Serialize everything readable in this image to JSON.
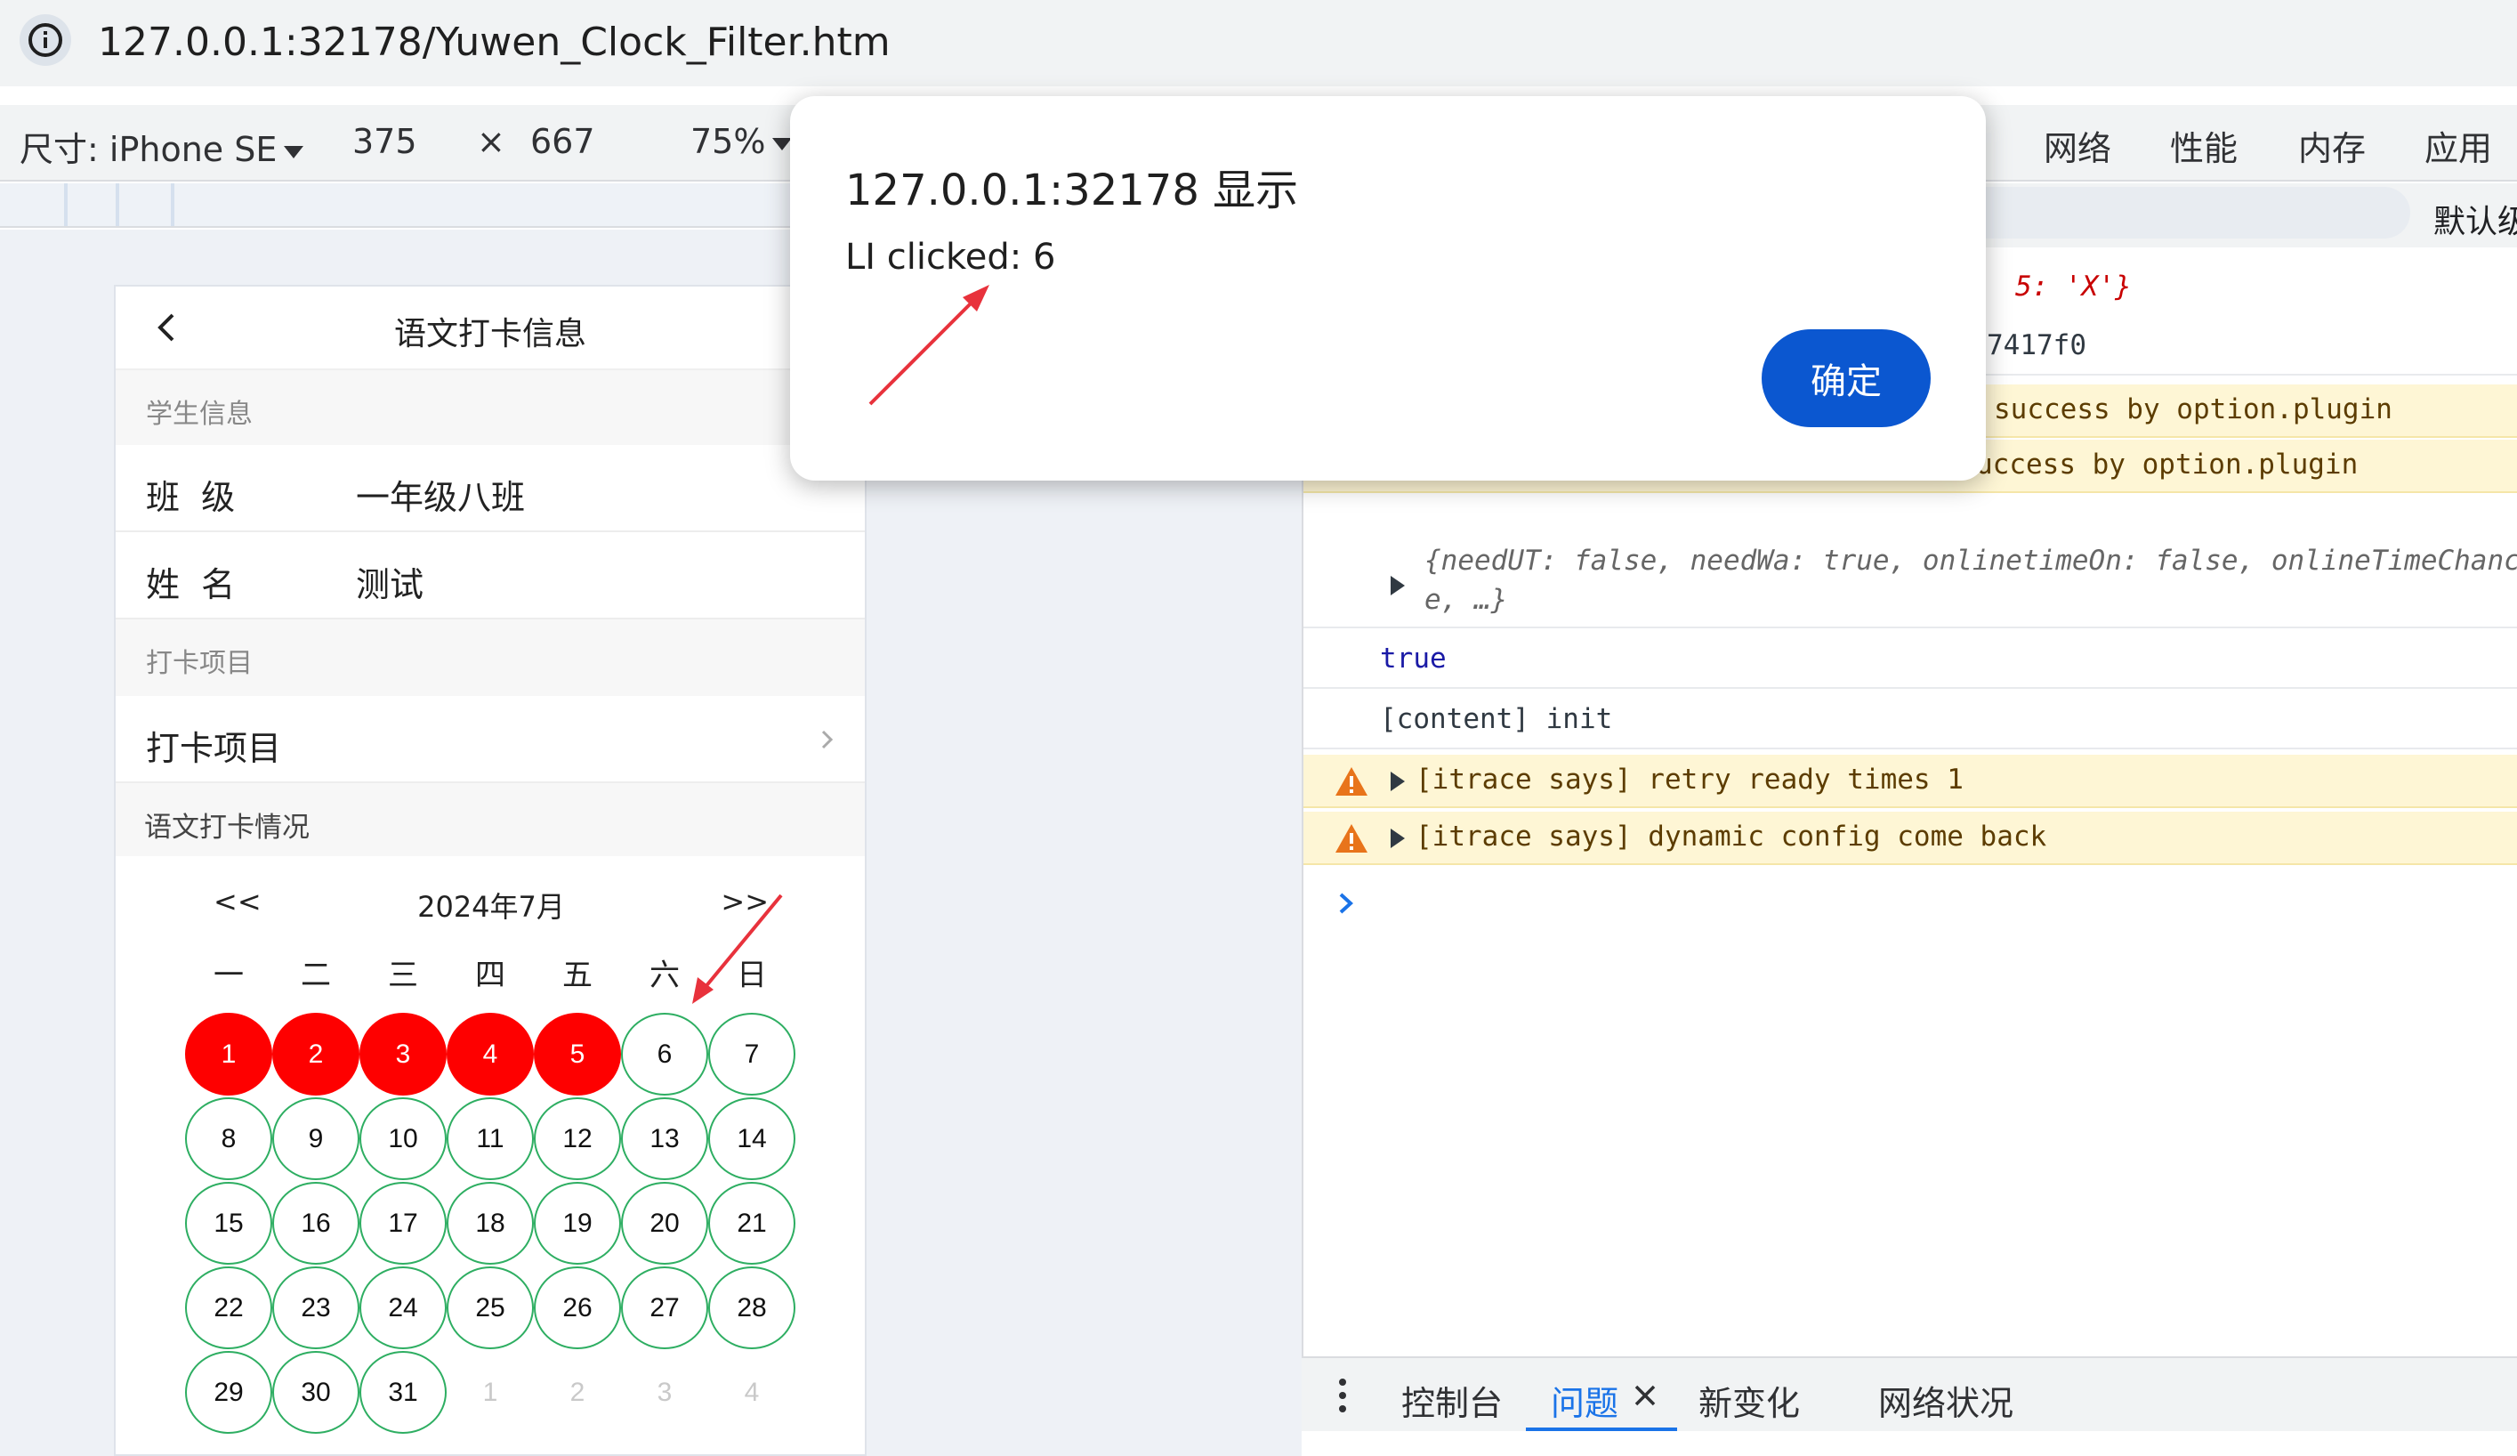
{
  "browser": {
    "url": "127.0.0.1:32178/Yuwen_Clock_Filter.htm"
  },
  "device_toolbar": {
    "device_label": "尺寸: iPhone SE",
    "width": "375",
    "times": "×",
    "height": "667",
    "zoom": "75%"
  },
  "devtools": {
    "tabs": [
      "网络",
      "性能",
      "内存",
      "应用"
    ],
    "level_filter": "默认级",
    "console_lines": {
      "obj_tail": "5: 'X'}",
      "hash_tail": "7417f0",
      "warn1": "success by option.plugin",
      "warn2": "uccess by option.plugin",
      "obj_line1": "{needUT: false, needWa: true, onlinetimeOn: false, onlineTimeChance:",
      "obj_line2": "e,  …}",
      "true_text": "true",
      "content_init": "[content] init",
      "itrace1": "[itrace says] retry ready times 1",
      "itrace2": "[itrace says] dynamic config come back"
    },
    "drawer_tabs": [
      "控制台",
      "问题",
      "新变化",
      "网络状况"
    ],
    "active_drawer_tab": "问题"
  },
  "phone": {
    "nav_title": "语文打卡信息",
    "student_section": "学生信息",
    "class_label": "班  级",
    "class_value": "一年级八班",
    "name_label": "姓  名",
    "name_value": "测试",
    "checkin_section": "打卡项目",
    "checkin_item": "打卡项目",
    "calendar_section": "语文打卡情况",
    "calendar": {
      "prev": "<<",
      "month": "2024年7月",
      "next": ">>",
      "weekdays": [
        "一",
        "二",
        "三",
        "四",
        "五",
        "六",
        "日"
      ],
      "days": [
        {
          "d": "1",
          "status": "done"
        },
        {
          "d": "2",
          "status": "done"
        },
        {
          "d": "3",
          "status": "done"
        },
        {
          "d": "4",
          "status": "done"
        },
        {
          "d": "5",
          "status": "done"
        },
        {
          "d": "6",
          "status": "open"
        },
        {
          "d": "7",
          "status": "open"
        },
        {
          "d": "8",
          "status": "open"
        },
        {
          "d": "9",
          "status": "open"
        },
        {
          "d": "10",
          "status": "open"
        },
        {
          "d": "11",
          "status": "open"
        },
        {
          "d": "12",
          "status": "open"
        },
        {
          "d": "13",
          "status": "open"
        },
        {
          "d": "14",
          "status": "open"
        },
        {
          "d": "15",
          "status": "open"
        },
        {
          "d": "16",
          "status": "open"
        },
        {
          "d": "17",
          "status": "open"
        },
        {
          "d": "18",
          "status": "open"
        },
        {
          "d": "19",
          "status": "open"
        },
        {
          "d": "20",
          "status": "open"
        },
        {
          "d": "21",
          "status": "open"
        },
        {
          "d": "22",
          "status": "open"
        },
        {
          "d": "23",
          "status": "open"
        },
        {
          "d": "24",
          "status": "open"
        },
        {
          "d": "25",
          "status": "open"
        },
        {
          "d": "26",
          "status": "open"
        },
        {
          "d": "27",
          "status": "open"
        },
        {
          "d": "28",
          "status": "open"
        },
        {
          "d": "29",
          "status": "open"
        },
        {
          "d": "30",
          "status": "open"
        },
        {
          "d": "31",
          "status": "open"
        },
        {
          "d": "1",
          "status": "other"
        },
        {
          "d": "2",
          "status": "other"
        },
        {
          "d": "3",
          "status": "other"
        },
        {
          "d": "4",
          "status": "other"
        }
      ]
    }
  },
  "dialog": {
    "title": "127.0.0.1:32178 显示",
    "message": "LI clicked: 6",
    "ok_label": "确定"
  },
  "colors": {
    "done_day": "#fe0000",
    "open_day_border": "#2eae62",
    "dialog_button": "#0b57d0",
    "annotation_arrow": "#e8323c",
    "console_warning_bg": "#fef6d5"
  }
}
